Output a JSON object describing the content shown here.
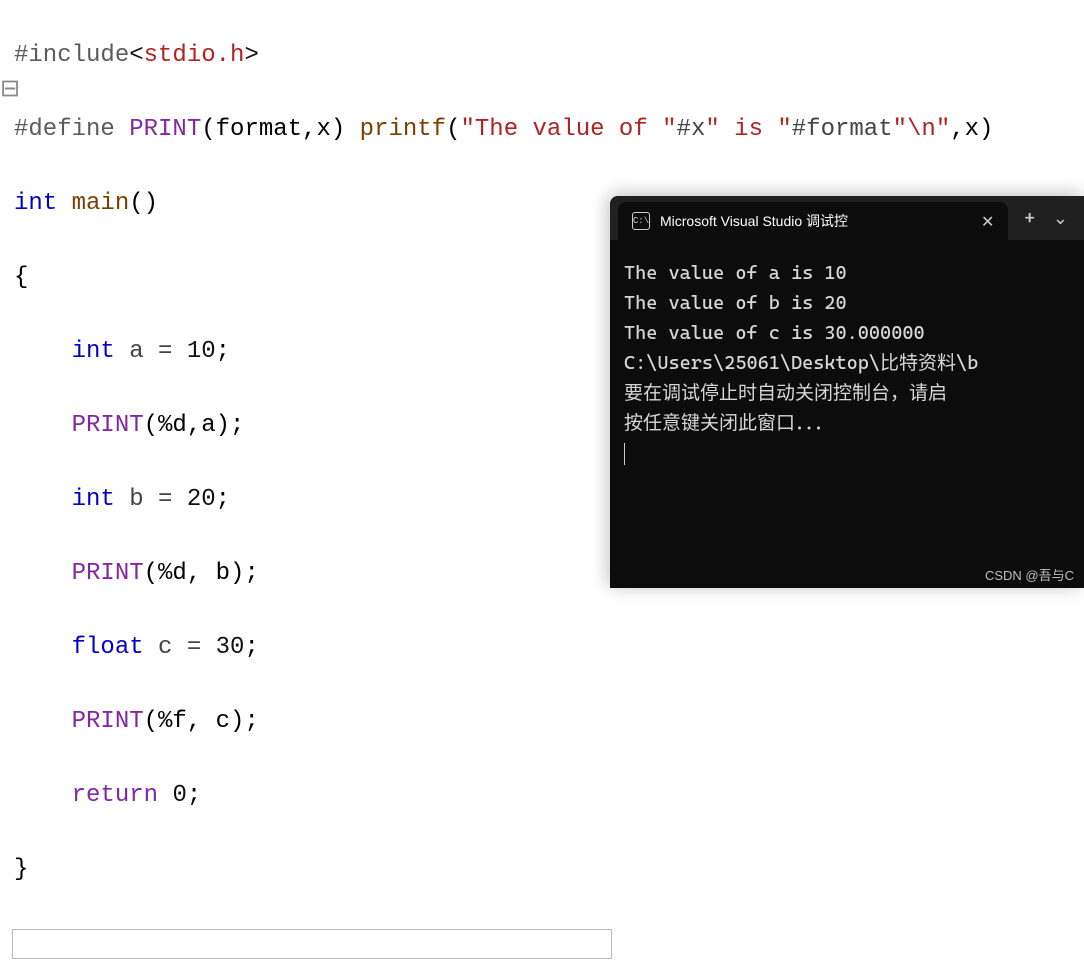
{
  "code": {
    "line1": {
      "directive": "#include",
      "open": "<",
      "header": "stdio.h",
      "close": ">"
    },
    "line2": {
      "directive": "#define ",
      "macro": "PRINT",
      "params": "(format,x) ",
      "fn": "printf",
      "args_open": "(",
      "str1": "\"The value of \"",
      "hash1": "#x",
      "str2": "\" is \"",
      "hash2": "#format",
      "str3": "\"\\n\"",
      "rest": ",x)"
    },
    "line3": {
      "kw": "int ",
      "fn": "main",
      "paren": "()"
    },
    "line4": "{",
    "line5": {
      "indent": "    ",
      "kw": "int ",
      "ident": "a = ",
      "num": "10",
      ";": ";"
    },
    "line6": {
      "indent": "    ",
      "macro": "PRINT",
      "args": "(%d,a);"
    },
    "line7": {
      "indent": "    ",
      "kw": "int ",
      "ident": "b = ",
      "num": "20",
      ";": ";"
    },
    "line8": {
      "indent": "    ",
      "macro": "PRINT",
      "args": "(%d, b);"
    },
    "line9": {
      "indent": "    ",
      "kw": "float ",
      "ident": "c = ",
      "num": "30",
      ";": ";"
    },
    "line10": {
      "indent": "    ",
      "macro": "PRINT",
      "args": "(%f, c);"
    },
    "line11": {
      "indent": "    ",
      "kw": "return ",
      "num": "0",
      ";": ";"
    },
    "line12": "}"
  },
  "terminal": {
    "title": "Microsoft Visual Studio 调试控",
    "new_tab": "+",
    "dropdown": "⌄",
    "icon_text": "C:\\",
    "output": {
      "l1": "The value of a is 10",
      "l2": "The value of b is 20",
      "l3": "The value of c is 30.000000",
      "blank": "",
      "l4": "C:\\Users\\25061\\Desktop\\比特资料\\b",
      "l5": "要在调试停止时自动关闭控制台，请启",
      "l6": "按任意键关闭此窗口．．．"
    }
  },
  "watermark": "CSDN @吾与C",
  "gutter_mark": "⊟"
}
